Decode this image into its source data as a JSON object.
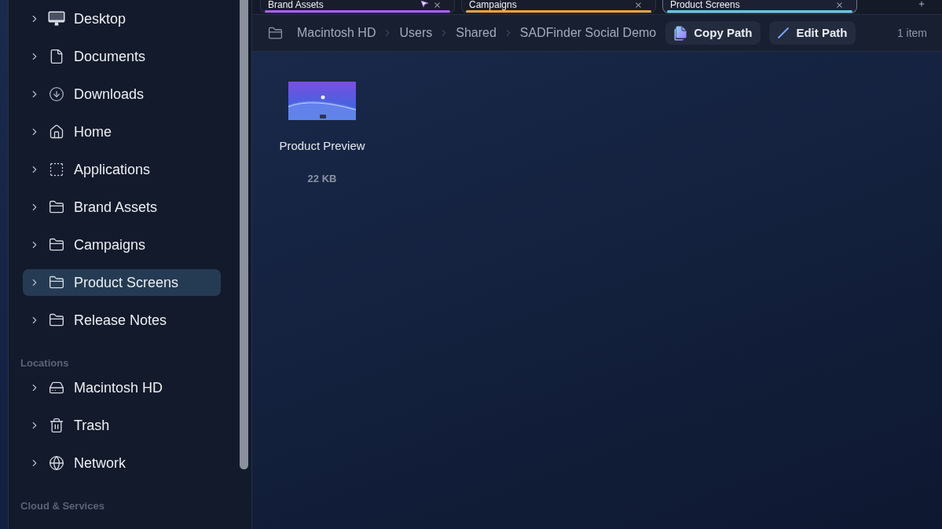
{
  "tabs": [
    {
      "label": "Brand Assets",
      "color": "#b05cf2",
      "selected": false,
      "cursor": true
    },
    {
      "label": "Campaigns",
      "color": "#f2a43a",
      "selected": false,
      "cursor": false
    },
    {
      "label": "Product Screens",
      "color": "#5cc8e2",
      "selected": true,
      "cursor": false
    }
  ],
  "sidebar": {
    "sections": [
      {
        "items": [
          {
            "label": "Desktop",
            "kind": "desktop",
            "selected": false,
            "expanded": false
          },
          {
            "label": "Documents",
            "kind": "document",
            "selected": false,
            "expanded": false
          },
          {
            "label": "Downloads",
            "kind": "download",
            "selected": false,
            "expanded": false
          },
          {
            "label": "Home",
            "kind": "home",
            "selected": false,
            "expanded": false
          },
          {
            "label": "Applications",
            "kind": "applications",
            "selected": false,
            "expanded": false
          },
          {
            "label": "Brand Assets",
            "kind": "folder",
            "selected": false,
            "expanded": false
          },
          {
            "label": "Campaigns",
            "kind": "folder",
            "selected": false,
            "expanded": false
          },
          {
            "label": "Product Screens",
            "kind": "folder",
            "selected": true,
            "expanded": false
          },
          {
            "label": "Release Notes",
            "kind": "folder",
            "selected": false,
            "expanded": false
          }
        ]
      },
      {
        "title": "Locations",
        "items": [
          {
            "label": "Macintosh HD",
            "kind": "disk",
            "selected": false,
            "expanded": false
          },
          {
            "label": "Trash",
            "kind": "trash",
            "selected": false,
            "expanded": false
          },
          {
            "label": "Network",
            "kind": "network",
            "selected": false,
            "expanded": false
          }
        ]
      },
      {
        "title": "Cloud & Services"
      }
    ]
  },
  "path_bar": {
    "path": [
      "Macintosh HD",
      "Users",
      "Shared",
      "SADFinder Social Demo"
    ],
    "buttons": [
      {
        "label": "Copy Path",
        "kind": "copy"
      },
      {
        "label": "Edit Path",
        "kind": "edit"
      }
    ],
    "item_count": "1 item"
  },
  "files": [
    {
      "name": "Product Preview",
      "size": "22 KB"
    }
  ]
}
